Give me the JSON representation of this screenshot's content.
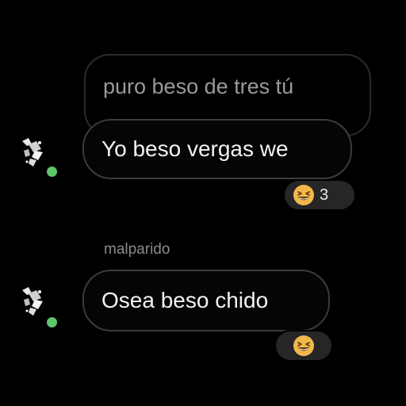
{
  "conversation": {
    "quoted_message": {
      "text": "puro beso de tres tú"
    },
    "messages": [
      {
        "text": "Yo beso vergas we",
        "reaction": {
          "emoji": "grinning-squinting-face",
          "count": "3"
        }
      },
      {
        "sender": "malparido",
        "text": "Osea beso chido",
        "reaction": {
          "emoji": "grinning-squinting-face"
        }
      }
    ]
  },
  "colors": {
    "background": "#000000",
    "bubble_border": "#3b3b3b",
    "reaction_pill": "#262626",
    "online_indicator": "#5cc66a",
    "emoji_face": "#f2b84b"
  }
}
